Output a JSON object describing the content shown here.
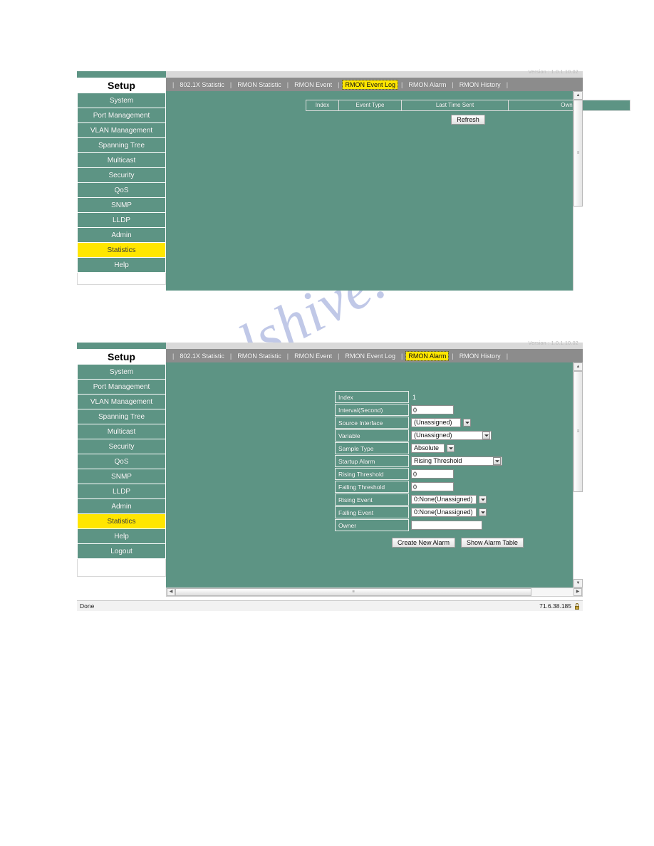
{
  "watermark": {
    "text": "manualshive.com"
  },
  "panel1": {
    "version_text": "Version : 1.0.1.10.02",
    "sidebar": {
      "title": "Setup",
      "items": [
        {
          "label": "System",
          "active": false
        },
        {
          "label": "Port Management",
          "active": false
        },
        {
          "label": "VLAN Management",
          "active": false
        },
        {
          "label": "Spanning Tree",
          "active": false
        },
        {
          "label": "Multicast",
          "active": false
        },
        {
          "label": "Security",
          "active": false
        },
        {
          "label": "QoS",
          "active": false
        },
        {
          "label": "SNMP",
          "active": false
        },
        {
          "label": "LLDP",
          "active": false
        },
        {
          "label": "Admin",
          "active": false
        },
        {
          "label": "Statistics",
          "active": true
        },
        {
          "label": "Help",
          "active": false
        }
      ]
    },
    "tabs": [
      {
        "label": "802.1X Statistic",
        "active": false
      },
      {
        "label": "RMON Statistic",
        "active": false
      },
      {
        "label": "RMON Event",
        "active": false
      },
      {
        "label": "RMON Event Log",
        "active": true
      },
      {
        "label": "RMON Alarm",
        "active": false
      },
      {
        "label": "RMON History",
        "active": false
      }
    ],
    "table": {
      "columns": [
        "Index",
        "Event Type",
        "Last Time Sent",
        "Owner"
      ],
      "rows": []
    },
    "refresh_label": "Refresh",
    "scroll": {
      "up": "▲",
      "down": "▼",
      "grip": "≡"
    }
  },
  "panel2": {
    "version_text": "Version : 1.0.1.10.02",
    "sidebar": {
      "title": "Setup",
      "items": [
        {
          "label": "System",
          "active": false
        },
        {
          "label": "Port Management",
          "active": false
        },
        {
          "label": "VLAN Management",
          "active": false
        },
        {
          "label": "Spanning Tree",
          "active": false
        },
        {
          "label": "Multicast",
          "active": false
        },
        {
          "label": "Security",
          "active": false
        },
        {
          "label": "QoS",
          "active": false
        },
        {
          "label": "SNMP",
          "active": false
        },
        {
          "label": "LLDP",
          "active": false
        },
        {
          "label": "Admin",
          "active": false
        },
        {
          "label": "Statistics",
          "active": true
        },
        {
          "label": "Help",
          "active": false
        },
        {
          "label": "Logout",
          "active": false
        }
      ]
    },
    "tabs": [
      {
        "label": "802.1X Statistic",
        "active": false
      },
      {
        "label": "RMON Statistic",
        "active": false
      },
      {
        "label": "RMON Event",
        "active": false
      },
      {
        "label": "RMON Event Log",
        "active": false
      },
      {
        "label": "RMON Alarm",
        "active": true
      },
      {
        "label": "RMON History",
        "active": false
      }
    ],
    "form": {
      "fields": [
        {
          "label": "Index",
          "type": "static",
          "value": "1"
        },
        {
          "label": "Interval(Second)",
          "type": "text",
          "value": "0",
          "w": 60
        },
        {
          "label": "Source Interface",
          "type": "select",
          "value": "(Unassigned)",
          "w": 70
        },
        {
          "label": "Variable",
          "type": "select",
          "value": "(Unassigned)",
          "w": 113
        },
        {
          "label": "Sample Type",
          "type": "select",
          "value": "Absolute",
          "w": 47
        },
        {
          "label": "Startup Alarm",
          "type": "select",
          "value": "Rising Threshold",
          "w": 128
        },
        {
          "label": "Rising Threshold",
          "type": "text",
          "value": "0",
          "w": 60
        },
        {
          "label": "Falling Threshold",
          "type": "text",
          "value": "0",
          "w": 60
        },
        {
          "label": "Rising Event",
          "type": "select",
          "value": "0:None(Unassigned)",
          "w": 92
        },
        {
          "label": "Falling Event",
          "type": "select",
          "value": "0:None(Unassigned)",
          "w": 92
        },
        {
          "label": "Owner",
          "type": "text",
          "value": "",
          "w": 100
        }
      ],
      "buttons": [
        {
          "label": "Create New Alarm"
        },
        {
          "label": "Show Alarm Table"
        }
      ]
    },
    "scroll": {
      "up": "▲",
      "down": "▼",
      "grip": "≡",
      "left": "◀",
      "right": "▶"
    },
    "statusbar": {
      "left": "Done",
      "right": "71.6.38.185"
    }
  }
}
